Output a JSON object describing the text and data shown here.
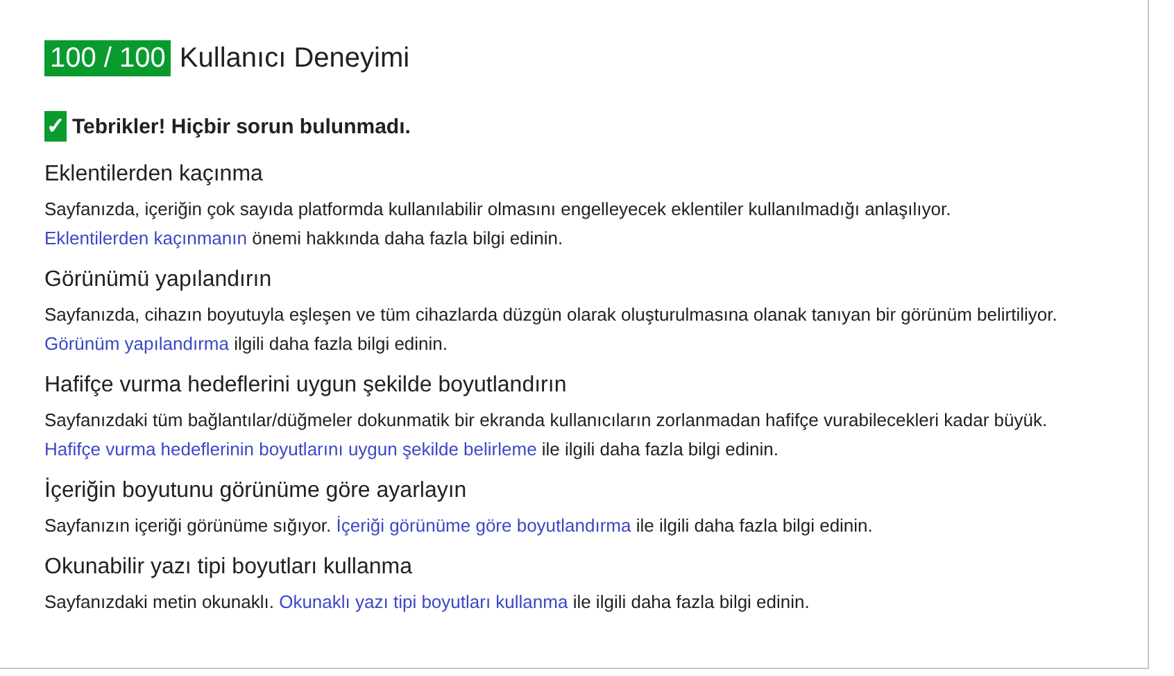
{
  "score": "100 / 100",
  "category_title": "Kullanıcı Deneyimi",
  "success": {
    "icon": "✓",
    "message": "Tebrikler! Hiçbir sorun bulunmadı."
  },
  "rules": [
    {
      "title": "Eklentilerden kaçınma",
      "before": "Sayfanızda, içeriğin çok sayıda platformda kullanılabilir olmasını engelleyecek eklentiler kullanılmadığı anlaşılıyor.",
      "link": "Eklentilerden kaçınmanın",
      "after": "önemi hakkında daha fazla bilgi edinin."
    },
    {
      "title": "Görünümü yapılandırın",
      "before": "Sayfanızda, cihazın boyutuyla eşleşen ve tüm cihazlarda düzgün olarak oluşturulmasına olanak tanıyan bir görünüm belirtiliyor.",
      "link": "Görünüm yapılandırma",
      "after": "ilgili daha fazla bilgi edinin."
    },
    {
      "title": "Hafifçe vurma hedeflerini uygun şekilde boyutlandırın",
      "before": "Sayfanızdaki tüm bağlantılar/düğmeler dokunmatik bir ekranda kullanıcıların zorlanmadan hafifçe vurabilecekleri kadar büyük.",
      "link": "Hafifçe vurma hedeflerinin boyutlarını uygun şekilde belirleme",
      "after": "ile ilgili daha fazla bilgi edinin."
    },
    {
      "title": "İçeriğin boyutunu görünüme göre ayarlayın",
      "before": "Sayfanızın içeriği görünüme sığıyor.",
      "link": "İçeriği görünüme göre boyutlandırma",
      "after": "ile ilgili daha fazla bilgi edinin."
    },
    {
      "title": "Okunabilir yazı tipi boyutları kullanma",
      "before": "Sayfanızdaki metin okunaklı.",
      "link": "Okunaklı yazı tipi boyutları kullanma",
      "after": "ile ilgili daha fazla bilgi edinin."
    }
  ]
}
